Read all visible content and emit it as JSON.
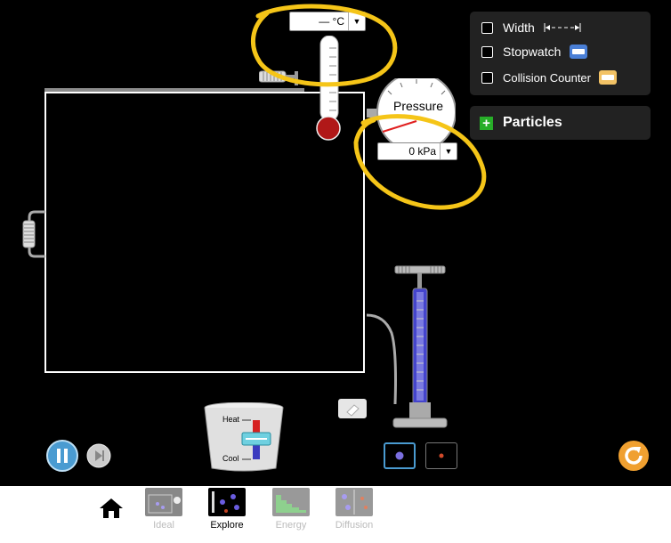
{
  "thermometer": {
    "value": "— °C",
    "dropdown_glyph": "▼"
  },
  "pressure": {
    "label": "Pressure",
    "value": "0 kPa",
    "dropdown_glyph": "▼"
  },
  "controls": {
    "width_label": "Width",
    "stopwatch_label": "Stopwatch",
    "collision_label": "Collision Counter",
    "width_checked": false,
    "stopwatch_checked": false,
    "collision_checked": false
  },
  "particles": {
    "label": "Particles",
    "plus": "+"
  },
  "heater": {
    "heat_label": "Heat",
    "cool_label": "Cool",
    "level": 0
  },
  "navbar": {
    "items": [
      {
        "label": "Ideal",
        "active": false
      },
      {
        "label": "Explore",
        "active": true
      },
      {
        "label": "Energy",
        "active": false
      },
      {
        "label": "Diffusion",
        "active": false
      }
    ]
  },
  "colors": {
    "annotation": "#f5c518",
    "accent_blue": "#4a9bd1",
    "reset_orange": "#f0a030",
    "plus_green": "#27ae28"
  }
}
